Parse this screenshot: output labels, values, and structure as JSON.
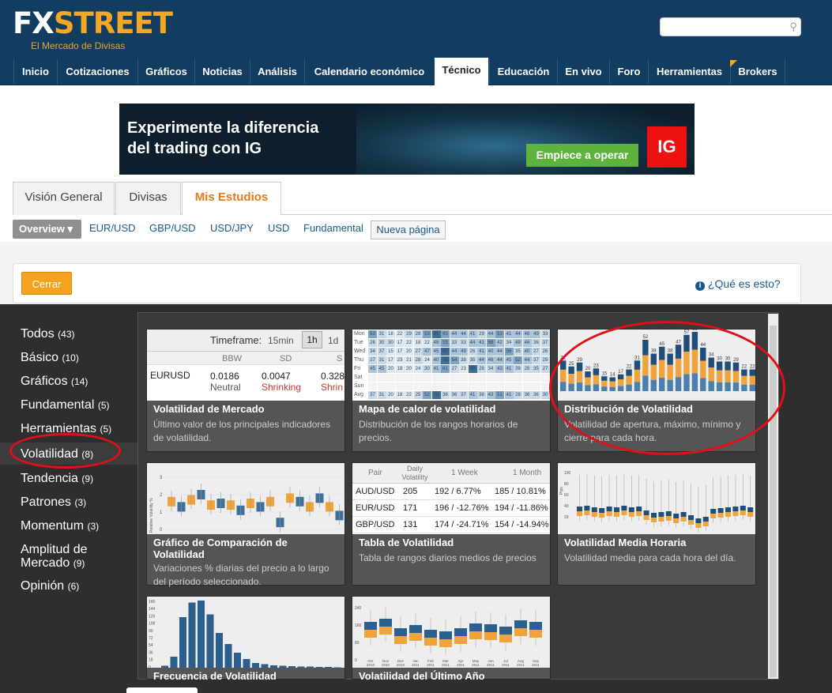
{
  "header": {
    "logo_fx": "FX",
    "logo_street": "STREET",
    "tagline": "El Mercado de Divisas",
    "search_placeholder": ""
  },
  "nav": [
    "Inicio",
    "Cotizaciones",
    "Gráficos",
    "Noticias",
    "Análisis",
    "Calendario económico",
    "Técnico",
    "Educación",
    "En vivo",
    "Foro",
    "Herramientas",
    "Brokers"
  ],
  "ad": {
    "line1": "Experimente la diferencia",
    "line2": "del trading con IG",
    "button": "Empiece a operar",
    "brand": "IG"
  },
  "tabs": [
    "Visión General",
    "Divisas",
    "Mis Estudios"
  ],
  "subnav": {
    "overview": "Overview",
    "links": [
      "EUR/USD",
      "GBP/USD",
      "USD/JPY",
      "USD",
      "Fundamental"
    ],
    "new_page": "Nueva página"
  },
  "toolbar": {
    "close": "Cerrar",
    "help": "¿Qué es esto?"
  },
  "categories": [
    {
      "label": "Todos",
      "count": "(43)"
    },
    {
      "label": "Básico",
      "count": "(10)"
    },
    {
      "label": "Gráficos",
      "count": "(14)"
    },
    {
      "label": "Fundamental",
      "count": "(5)"
    },
    {
      "label": "Herramientas",
      "count": "(5)"
    },
    {
      "label": "Volatilidad",
      "count": "(8)"
    },
    {
      "label": "Tendencia",
      "count": "(9)"
    },
    {
      "label": "Patrones",
      "count": "(3)"
    },
    {
      "label": "Momentum",
      "count": "(3)"
    },
    {
      "label": "Amplitud de Mercado",
      "count": "(9)"
    },
    {
      "label": "Opinión",
      "count": "(6)"
    }
  ],
  "cards": [
    {
      "title": "Volatilidad de Mercado",
      "desc": "Último valor de los principales indicadores de volatilidad."
    },
    {
      "title": "Mapa de calor de volatilidad",
      "desc": "Distribución de los rangos horarios de precios."
    },
    {
      "title": "Distribución de Volatilidad",
      "desc": "Volatilidad de apertura, máximo, mínimo y cierre para cada hora."
    },
    {
      "title": "Gráfico de Comparación de Volatilidad",
      "desc": "Variaciones % diarias del precio a lo largo del período seleccionado."
    },
    {
      "title": "Tabla de Volatilidad",
      "desc": "Tabla de rangos diarios medios de precios"
    },
    {
      "title": "Volatilidad Media Horaria",
      "desc": "Volatilidad media para cada hora del día."
    },
    {
      "title": "Frecuencia de Volatilidad",
      "desc": ""
    },
    {
      "title": "Volatilidad del Último Año",
      "desc": ""
    }
  ],
  "vol_market": {
    "timeframe_label": "Timeframe:",
    "options": [
      "15min",
      "1h",
      "1d"
    ],
    "cols": [
      "BBW",
      "SD",
      "S"
    ],
    "pair": "EURUSD",
    "values": [
      "0.0186",
      "0.0047",
      "0.328"
    ],
    "states": [
      "Neutral",
      "Shrinking",
      "Shrin"
    ]
  },
  "vol_table": {
    "cols": [
      "Pair",
      "Daily Volatility",
      "1 Week",
      "1 Month"
    ],
    "rows": [
      [
        "AUD/USD",
        "205",
        "192 / 6.77%",
        "185 / 10.81%"
      ],
      [
        "EUR/USD",
        "171",
        "196 / -12.76%",
        "194 / -11.86%"
      ],
      [
        "GBP/USD",
        "131",
        "174 / -24.71%",
        "154 / -14.94%"
      ]
    ]
  },
  "heatmap": {
    "days": [
      "Mon",
      "Tue",
      "Wed",
      "Thu",
      "Fri",
      "Sat",
      "Sun",
      "Avg"
    ],
    "rows": [
      [
        "53",
        "31",
        "18",
        "22",
        "29",
        "28",
        "53",
        "81",
        "65",
        "44",
        "44",
        "41",
        "29",
        "44",
        "53",
        "41",
        "44",
        "46",
        "49",
        "33"
      ],
      [
        "26",
        "30",
        "30",
        "17",
        "22",
        "18",
        "22",
        "49",
        "55",
        "33",
        "33",
        "44",
        "41",
        "68",
        "42",
        "34",
        "49",
        "46",
        "36",
        "37"
      ],
      [
        "34",
        "37",
        "15",
        "17",
        "20",
        "27",
        "47",
        "45",
        "90",
        "44",
        "49",
        "26",
        "41",
        "40",
        "44",
        "56",
        "35",
        "40",
        "27",
        "26"
      ],
      [
        "27",
        "31",
        "17",
        "23",
        "21",
        "28",
        "24",
        "40",
        "78",
        "54",
        "38",
        "35",
        "44",
        "46",
        "44",
        "45",
        "52",
        "44",
        "37",
        "29"
      ],
      [
        "45",
        "45",
        "20",
        "18",
        "20",
        "24",
        "30",
        "41",
        "61",
        "27",
        "23",
        "99",
        "28",
        "34",
        "43",
        "41",
        "39",
        "28",
        "35",
        "27"
      ],
      [],
      [],
      [
        "37",
        "31",
        "20",
        "18",
        "22",
        "25",
        "52",
        "70",
        "36",
        "36",
        "37",
        "41",
        "38",
        "43",
        "51",
        "41",
        "28",
        "36",
        "36",
        "30"
      ]
    ]
  },
  "dist_labels": [
    "31",
    "25",
    "29",
    "20",
    "23",
    "15",
    "14",
    "17",
    "22",
    "31",
    "52",
    "38",
    "45",
    "38",
    "47",
    "57",
    "60",
    "44",
    "34",
    "30",
    "30",
    "29",
    "22",
    "22"
  ],
  "compare_y": [
    "3",
    "2",
    "1",
    "0"
  ],
  "compare_ylabel": "Relative Volatility %",
  "freq_y": [
    "160",
    "144",
    "126",
    "108",
    "90",
    "72",
    "54",
    "36",
    "18",
    "0"
  ],
  "year_y": [
    "240",
    "160",
    "80",
    "0"
  ],
  "year_x": [
    "Oct 2010",
    "Nov 2010",
    "Dec 2010",
    "Jan 2011",
    "Feb 2011",
    "Mar 2011",
    "Apr 2011",
    "May 2011",
    "Jun 2011",
    "Jul 2011",
    "Aug 2011",
    "Sep 2011"
  ],
  "hourly_y": [
    "100",
    "80",
    "60",
    "40",
    "20"
  ],
  "hourly_ylabel": "Pips"
}
